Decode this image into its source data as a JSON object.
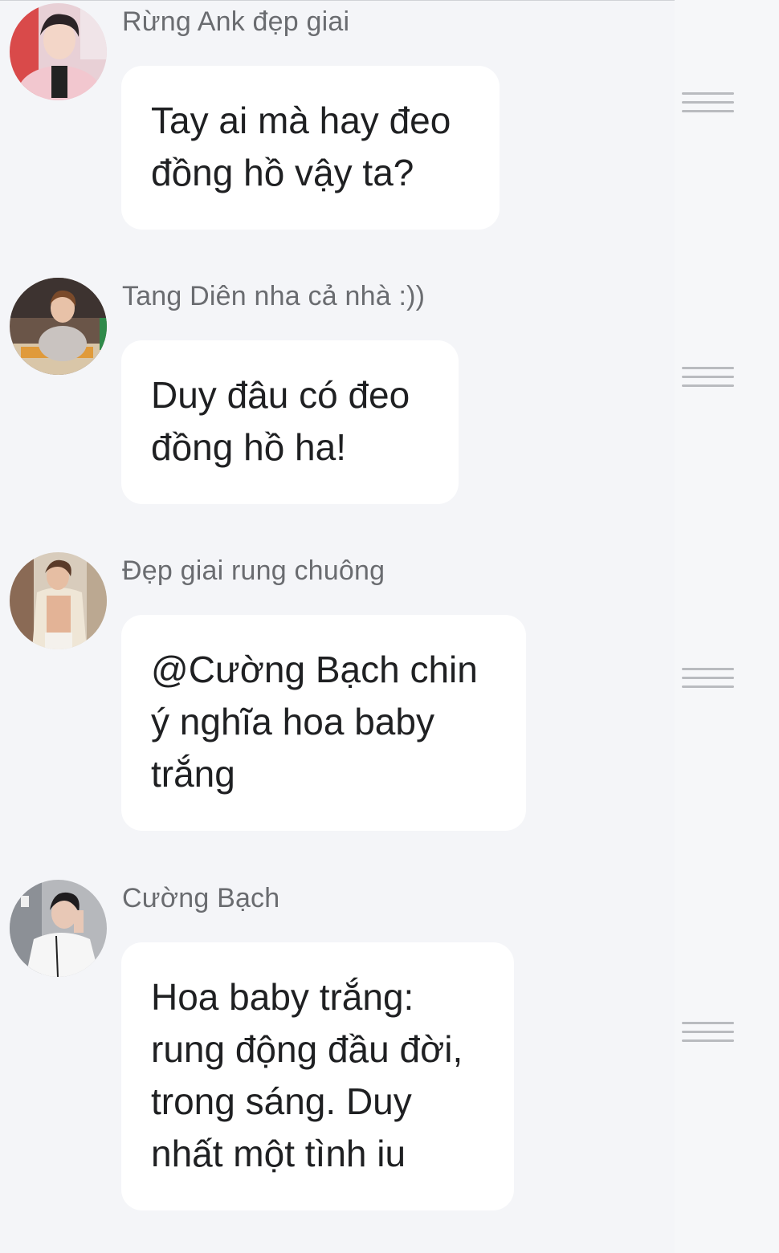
{
  "messages": [
    {
      "author": "Rừng Ank đẹp giai",
      "text": "Tay ai mà hay đeo\nđồng hồ vậy ta?",
      "avatar_icon": "user-avatar-photo"
    },
    {
      "author": "Tang Diên nha cả nhà :))",
      "text": "Duy đâu có đeo\nđồng hồ ha!",
      "avatar_icon": "user-avatar-photo"
    },
    {
      "author": "Đẹp giai rung chuông",
      "text": "@Cường Bạch  chin\ný nghĩa hoa baby\ntrắng",
      "avatar_icon": "user-avatar-photo"
    },
    {
      "author": "Cường Bạch",
      "text": "Hoa baby trắng:\nrung động đầu đời,\ntrong sáng. Duy\nnhất một tình iu",
      "avatar_icon": "user-avatar-photo"
    }
  ],
  "options_icon": "hamburger-menu-icon",
  "colors": {
    "background": "#f4f5f8",
    "bubble": "#ffffff",
    "author_text": "#6a6c70",
    "message_text": "#1f2022",
    "menu_icon": "#b9bbbf"
  }
}
